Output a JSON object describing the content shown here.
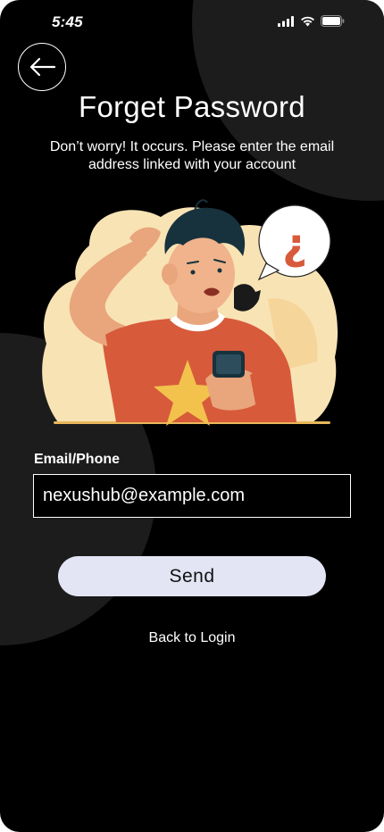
{
  "status_bar": {
    "time": "5:45",
    "icons": [
      "signal-icon",
      "wifi-icon",
      "battery-icon"
    ]
  },
  "header": {
    "back_icon": "arrow-left-icon",
    "title": "Forget Password",
    "subtitle": "Don’t worry! It occurs. Please enter the email address linked with your account"
  },
  "illustration": {
    "description_icon": "confused-person-with-phone-illustration",
    "bubble_symbol": "¿"
  },
  "form": {
    "email_label": "Email/Phone",
    "email_value": "nexushub@example.com"
  },
  "actions": {
    "send_label": "Send",
    "back_to_login_label": "Back to Login"
  },
  "colors": {
    "background": "#000000",
    "blob": "#1c1c1c",
    "button_bg": "#e3e5f4",
    "illustration_cream": "#f8e3b4",
    "shirt": "#d75a3b",
    "star": "#f2c24c",
    "hair": "#17323d"
  }
}
